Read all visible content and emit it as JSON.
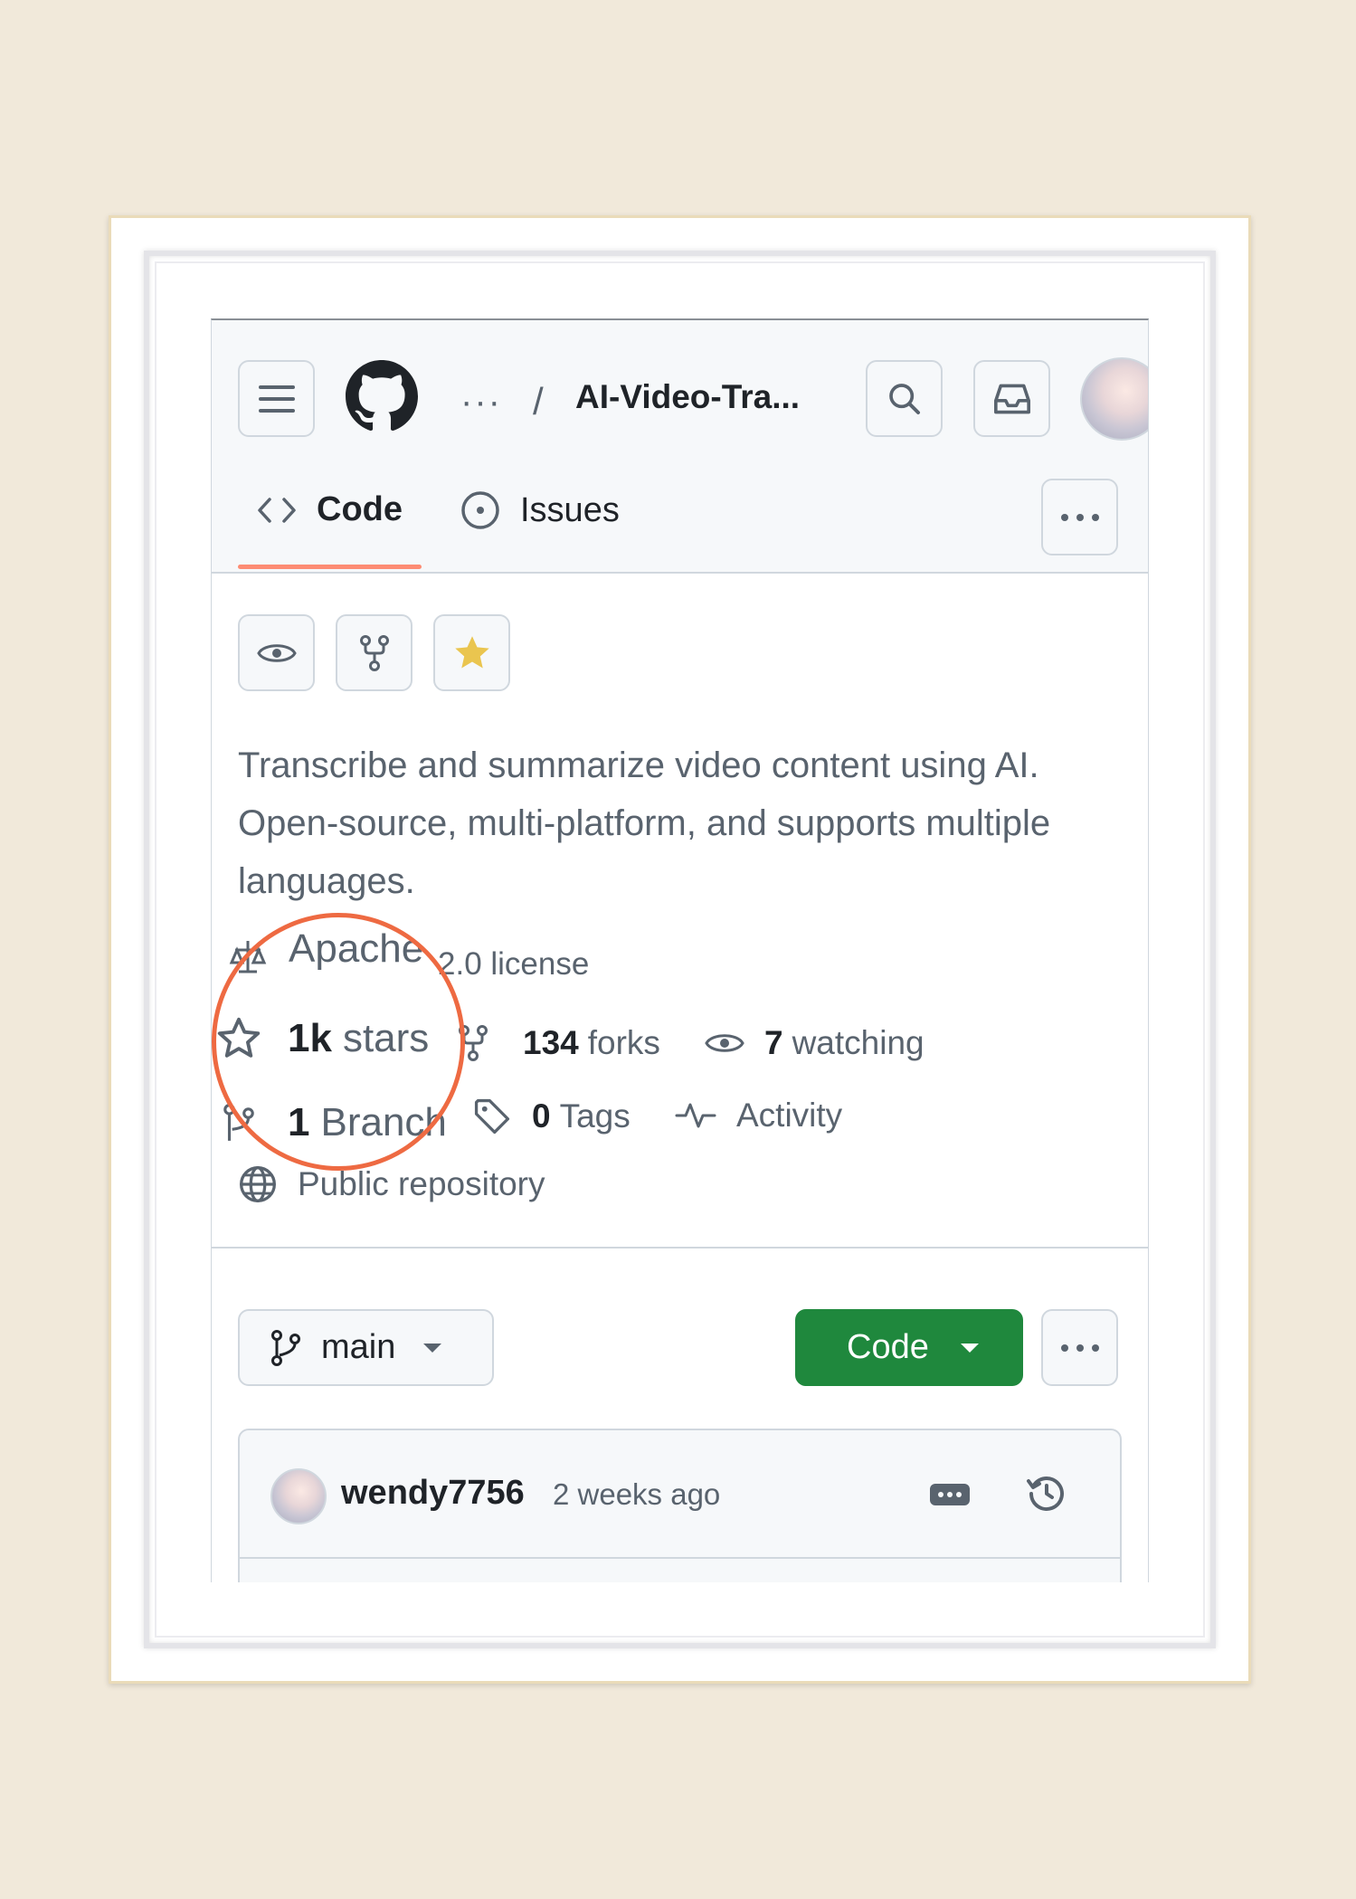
{
  "header": {
    "breadcrumb_dots": "···",
    "breadcrumb_separator": "/",
    "repo_name": "AI-Video-Tra..."
  },
  "tabs": [
    {
      "label": "Code",
      "icon": "code-icon",
      "active": true
    },
    {
      "label": "Issues",
      "icon": "issue-opened-icon",
      "active": false
    }
  ],
  "repo": {
    "description": "Transcribe and summarize video content using AI. Open-source, multi-platform, and supports multiple languages.",
    "license_partial": "Apache",
    "license_rest": "2.0 license",
    "stars_count": "1k",
    "stars_label": "stars",
    "forks_count": "134",
    "forks_label": "forks",
    "watching_count": "7",
    "watching_label": "watching",
    "branches_count": "1",
    "branches_label": "Branch",
    "tags_count": "0",
    "tags_label": "Tags",
    "activity_label": "Activity",
    "visibility_label": "Public repository"
  },
  "toolbar": {
    "branch_label": "main",
    "code_button_label": "Code"
  },
  "commit": {
    "author": "wendy7756",
    "time": "2 weeks ago"
  },
  "colors": {
    "accent_underline": "#fd8c73",
    "code_button": "#1f883d",
    "annotation_circle": "#ee6a42",
    "star_fill": "#eac54f",
    "frame_background": "#f1e9da"
  }
}
